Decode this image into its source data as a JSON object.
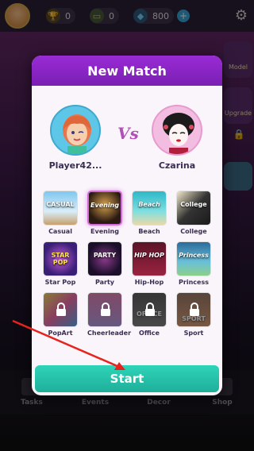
{
  "topbar": {
    "trophies": "0",
    "cash": "0",
    "gems": "800"
  },
  "side": {
    "model": "Model",
    "upgrade": "Upgrade"
  },
  "bottom_nav": [
    "Tasks",
    "Events",
    "Decor",
    "Shop"
  ],
  "modal": {
    "title": "New Match",
    "vs": "Vs",
    "player1": "Player42...",
    "player2": "Czarina",
    "start": "Start"
  },
  "themes": [
    {
      "name": "Casual",
      "thumb": "CASUAL"
    },
    {
      "name": "Evening",
      "thumb": "Evening"
    },
    {
      "name": "Beach",
      "thumb": "Beach"
    },
    {
      "name": "College",
      "thumb": "College"
    },
    {
      "name": "Star Pop",
      "thumb": "STAR POP"
    },
    {
      "name": "Party",
      "thumb": "PARTY"
    },
    {
      "name": "Hip-Hop",
      "thumb": "HIP HOP"
    },
    {
      "name": "Princess",
      "thumb": "Princess"
    },
    {
      "name": "PopArt",
      "thumb": ""
    },
    {
      "name": "Cheerleader",
      "thumb": ""
    },
    {
      "name": "Office",
      "thumb": "OFFICE"
    },
    {
      "name": "Sport",
      "thumb": "SPORT"
    }
  ],
  "colors": {
    "header": "#9a2bd6",
    "start": "#2ed4b9",
    "arrow": "#e8221c"
  }
}
